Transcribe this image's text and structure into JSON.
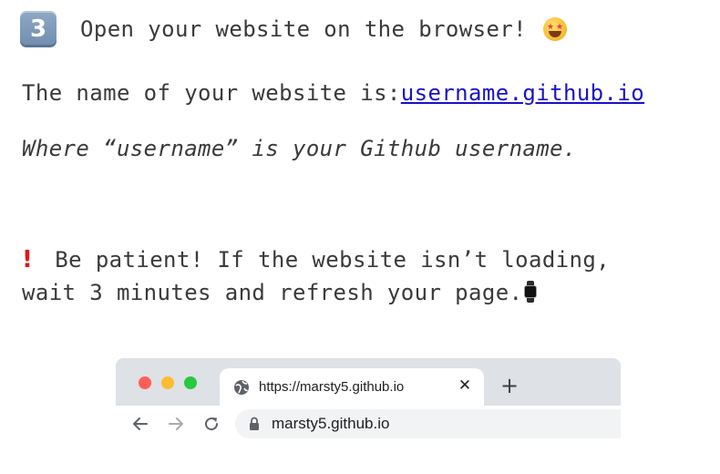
{
  "step": {
    "number": "3",
    "text": "Open your website on the browser!",
    "emoji_icon": "star-struck-emoji-icon"
  },
  "website_line": {
    "prefix": "The name of your website is:",
    "link_text": "username.github.io"
  },
  "note": "Where “username” is your Github username.",
  "warning": {
    "icon": "exclamation-icon",
    "line1": "Be patient! If the website isn’t loading,",
    "line2": "wait 3 minutes and refresh your page.",
    "emoji_icon": "watch-emoji-icon"
  },
  "browser": {
    "tab_title": "https://marsty5.github.io",
    "tab_close": "✕",
    "new_tab": "+",
    "address": "marsty5.github.io",
    "colors": {
      "close": "#ff5f57",
      "minimize": "#febc2e",
      "maximize": "#28c840",
      "tabstrip": "#dee1e6",
      "omnibox": "#f1f3f4"
    }
  },
  "colors": {
    "text": "#3a3a3a",
    "link": "#1a12c9",
    "warning": "#e0161b"
  }
}
